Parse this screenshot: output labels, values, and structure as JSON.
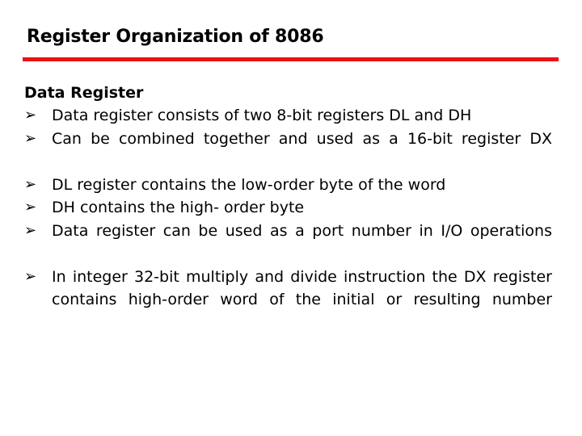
{
  "slide": {
    "title": "Register Organization of 8086",
    "accent_color": "#ee1111",
    "background_color": "#ffffff",
    "text_color": "#000000",
    "subheading": "Data Register",
    "bullet_marker": "➢",
    "bullets": [
      {
        "text": "Data register consists of two 8-bit registers DL and DH",
        "justified": false
      },
      {
        "text": "Can be combined together and used as a 16-bit register DX",
        "justified": true
      },
      {
        "text": "DL register contains the low-order byte of the word",
        "justified": false
      },
      {
        "text": "DH contains the high- order byte",
        "justified": false
      },
      {
        "text": "Data register can be used as a port number in I/O operations",
        "justified": true
      },
      {
        "text": "In integer 32-bit multiply and divide instruction the DX register contains high-order word of the initial or resulting number",
        "justified": true
      }
    ]
  }
}
